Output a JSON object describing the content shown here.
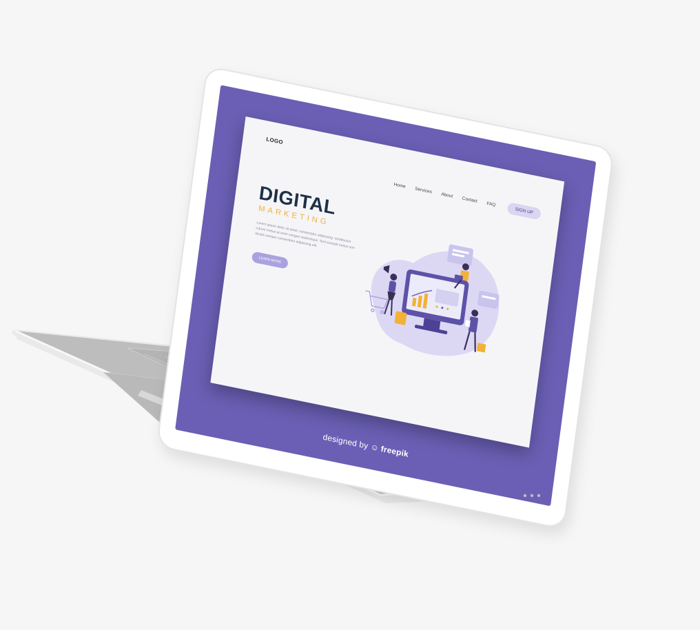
{
  "landing": {
    "logo": "LOGO",
    "nav": [
      "Home",
      "Services",
      "About",
      "Contact",
      "FAQ"
    ],
    "signup_label": "SIGN UP",
    "hero_title": "DIGITAL",
    "hero_subtitle": "MARKETING",
    "hero_body": "Lorem ipsum dolor sit amet, consectetur adipiscing. Vestibulum rutrum metus at enim congue scelerisque. Sed suscipit metus non iaculis semper consectetur adipiscing elit.",
    "learn_more_label": "LEARN MORE"
  },
  "credit": {
    "designed_by": "designed by",
    "brand": "freepik",
    "brand_icon": "freepik-logo-icon"
  },
  "colors": {
    "screen_purple": "#6a5fb4",
    "title_navy": "#1e3147",
    "accent_orange": "#f2b137",
    "soft_lavender": "#d9d5f2"
  }
}
